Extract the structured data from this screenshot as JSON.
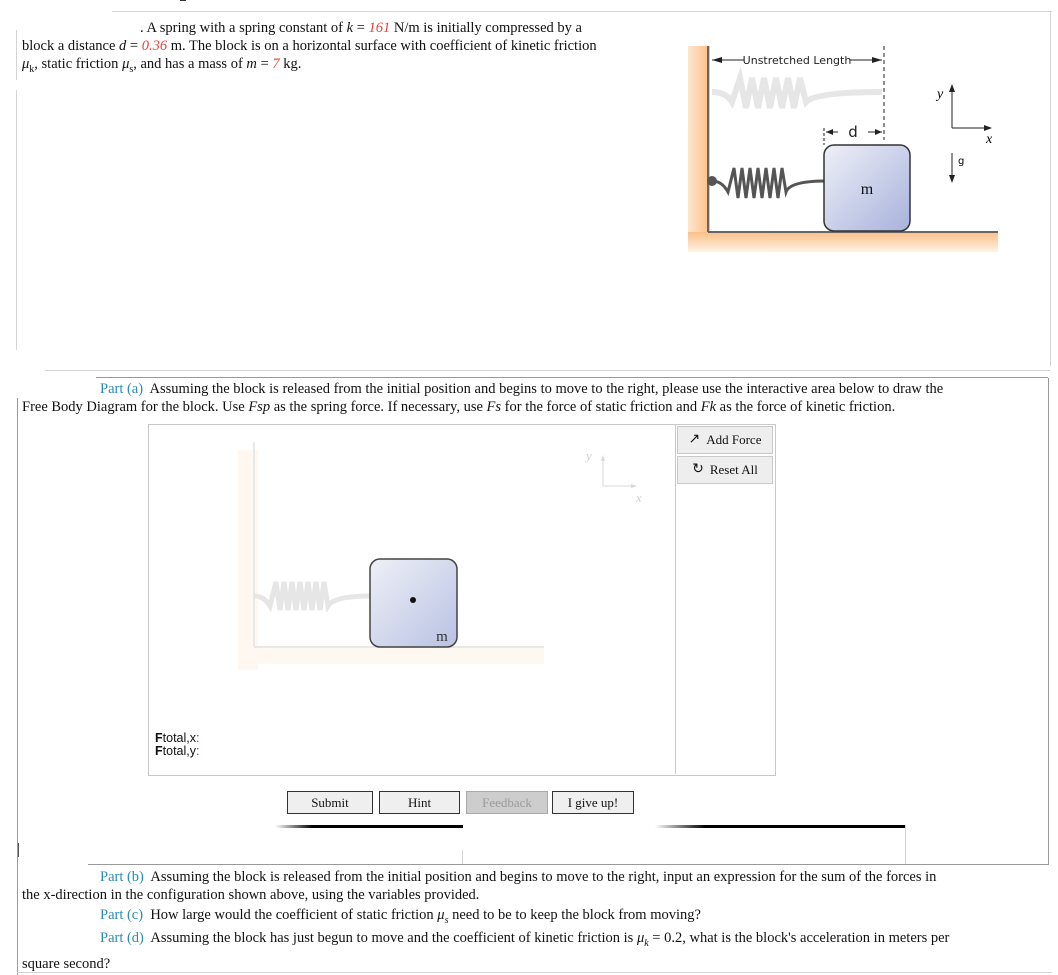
{
  "problem": {
    "intro_pre_k": "A spring with a spring constant of ",
    "k_symbol": "k",
    "k_value": "161",
    "k_unit": " N/m is initially compressed by a",
    "line2_pre_d": "block a distance ",
    "d_symbol": "d",
    "d_value": "0.36",
    "line2_post_d": " m. The block is on a horizontal surface with coefficient of kinetic friction",
    "mu_k": "μ",
    "mu_k_sub": "k",
    "line3_mid": ", static friction ",
    "mu_s": "μ",
    "mu_s_sub": "s",
    "line3_post": ", and has a mass of ",
    "m_symbol": "m",
    "m_value": "7",
    "m_unit": " kg."
  },
  "figure": {
    "unstretched_label": "Unstretched Length",
    "d_label": "d",
    "mass_label": "m",
    "axis_y": "y",
    "axis_x": "x",
    "gravity_label": "g"
  },
  "part_a": {
    "label": "Part (a)",
    "text1": "Assuming the block is released from the initial position and begins to move to the right, please use the interactive area below to draw the",
    "text2_pre": "Free Body Diagram for the block. Use ",
    "fsp": "Fsp",
    "text2_mid1": " as the spring force. If necessary, use ",
    "fs": "Fs",
    "text2_mid2": " for the force of static friction and ",
    "fk": "Fk",
    "text2_post": " as the force of kinetic friction."
  },
  "fbd": {
    "add_force": "Add Force",
    "reset_all": "Reset All",
    "mass_label": "m",
    "axis_y": "y",
    "axis_x": "x",
    "ftotal_x_F": "F",
    "ftotal_x_sub": "total,x",
    "ftotal_y_F": "F",
    "ftotal_y_sub": "total,y",
    "colon": ":"
  },
  "actions": {
    "submit": "Submit",
    "hint": "Hint",
    "feedback": "Feedback",
    "give_up": "I give up!"
  },
  "part_b": {
    "label": "Part (b)",
    "text1": "Assuming the block is released from the initial position and begins to move to the right, input an expression for the sum of the forces in",
    "text2": "the x-direction in the configuration shown above, using the variables provided."
  },
  "part_c": {
    "label": "Part (c)",
    "text_pre": "How large would the coefficient of static friction ",
    "mu": "μ",
    "mu_sub": "s",
    "text_post": " need to be to keep the block from moving?"
  },
  "part_d": {
    "label": "Part (d)",
    "text_pre": "Assuming the block has just begun to move and the coefficient of kinetic friction is ",
    "mu": "μ",
    "mu_sub": "k",
    "mu_value": " = 0.2",
    "text_post": ", what is the block's acceleration in meters per",
    "text2": "square second?"
  },
  "colors": {
    "part_label": "#2a8db0",
    "given_value": "#e8413a"
  }
}
